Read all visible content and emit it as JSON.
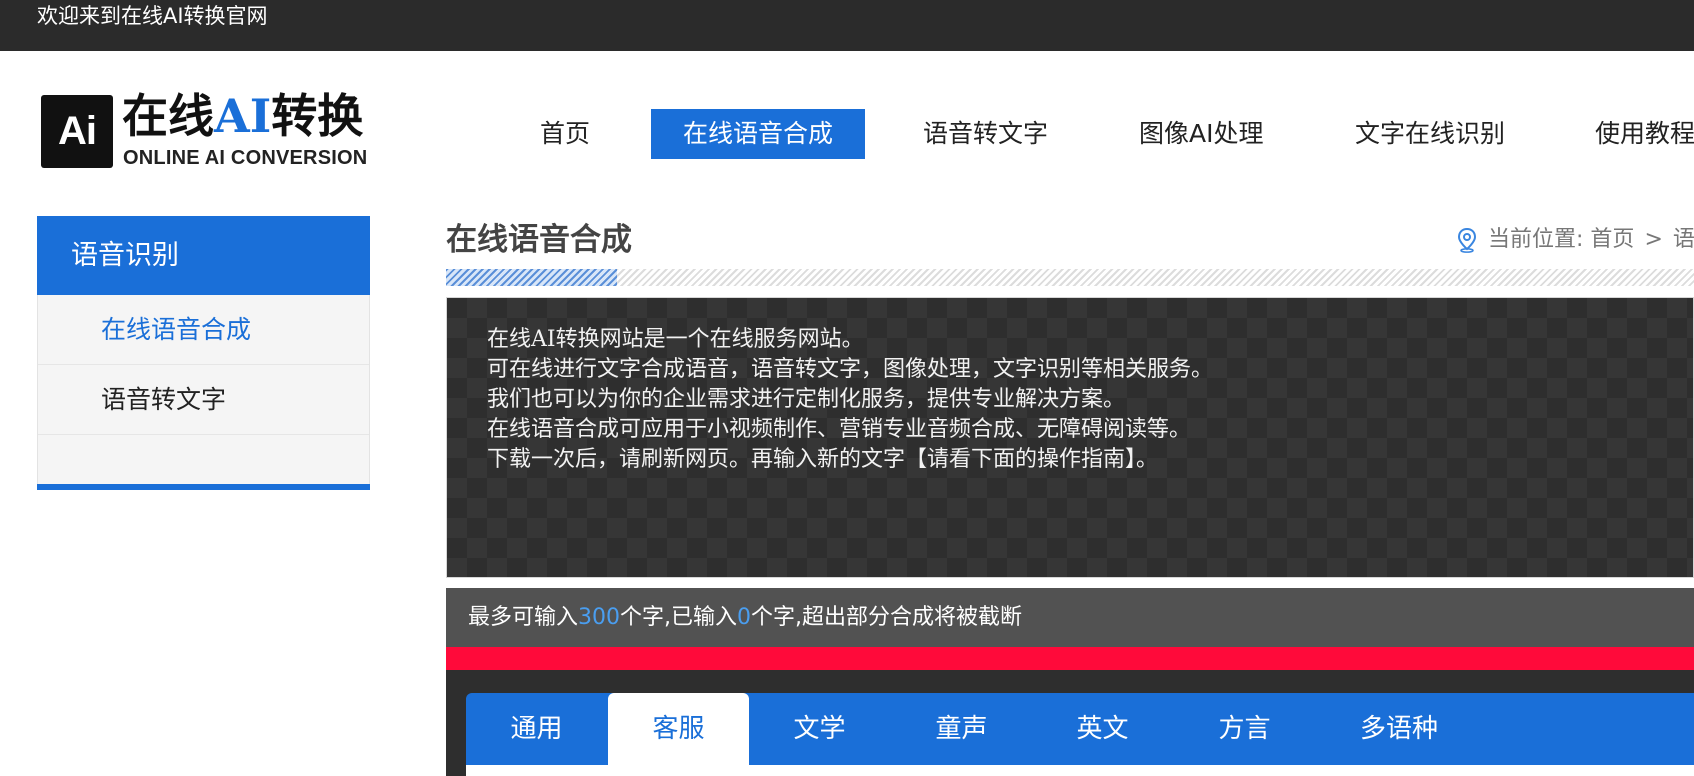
{
  "topbar": {
    "welcome": "欢迎来到在线AI转换官网"
  },
  "logo": {
    "badge": "Ai",
    "brand_pre": "在线",
    "brand_ai": "AI",
    "brand_post": "转换",
    "subtitle": "ONLINE AI CONVERSION"
  },
  "nav": {
    "items": [
      {
        "label": "首页"
      },
      {
        "label": "在线语音合成",
        "active": true
      },
      {
        "label": "语音转文字"
      },
      {
        "label": "图像AI处理"
      },
      {
        "label": "文字在线识别"
      },
      {
        "label": "使用教程"
      }
    ]
  },
  "sidebar": {
    "heading": "语音识别",
    "items": [
      {
        "label": "在线语音合成",
        "current": true
      },
      {
        "label": "语音转文字"
      }
    ]
  },
  "page": {
    "title": "在线语音合成"
  },
  "breadcrumb": {
    "prefix": "当前位置:",
    "home": "首页",
    "separator": ">",
    "current": "语音"
  },
  "info": {
    "lines": [
      "在线AI转换网站是一个在线服务网站。",
      "可在线进行文字合成语音，语音转文字，图像处理，文字识别等相关服务。",
      "我们也可以为你的企业需求进行定制化服务，提供专业解决方案。",
      "在线语音合成可应用于小视频制作、营销专业音频合成、无障碍阅读等。",
      "下载一次后，请刷新网页。再输入新的文字【请看下面的操作指南】。"
    ]
  },
  "counter": {
    "prefix": "最多可输入",
    "max": "300",
    "middle": "个字,已输入",
    "count": "0",
    "suffix": "个字,超出部分合成将被截断"
  },
  "voice_tabs": {
    "items": [
      {
        "label": "通用"
      },
      {
        "label": "客服",
        "active": true
      },
      {
        "label": "文学"
      },
      {
        "label": "童声"
      },
      {
        "label": "英文"
      },
      {
        "label": "方言"
      },
      {
        "label": "多语种"
      }
    ]
  },
  "colors": {
    "accent": "#1a6fd8",
    "topbar": "#2b2b2b",
    "alert_bar": "#ff0a3a",
    "counter_highlight": "#4a9ef0"
  }
}
